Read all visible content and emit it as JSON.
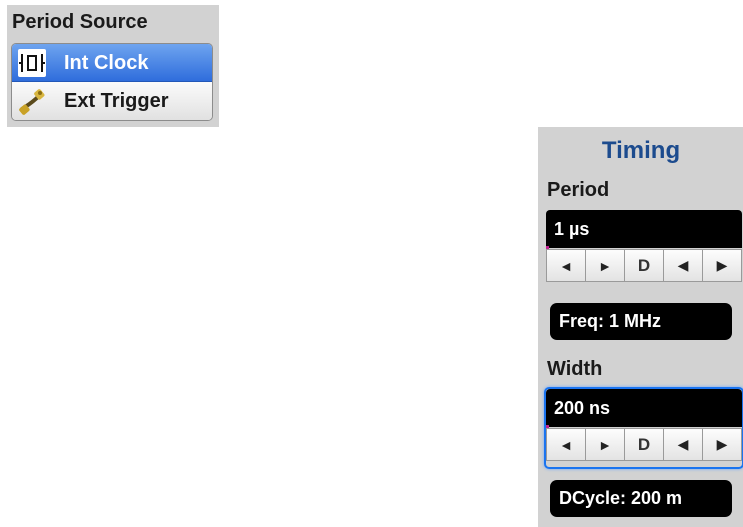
{
  "period_source": {
    "title": "Period Source",
    "options": [
      {
        "label": "Int Clock",
        "icon": "clock-signal-icon",
        "selected": true
      },
      {
        "label": "Ext Trigger",
        "icon": "trigger-cable-icon",
        "selected": false
      }
    ]
  },
  "timing": {
    "title": "Timing",
    "period": {
      "label": "Period",
      "value": "1 µs",
      "stepper": [
        "◄",
        "►",
        "D",
        "◀",
        "▶"
      ],
      "info": "Freq: 1 MHz"
    },
    "width": {
      "label": "Width",
      "value": "200 ns",
      "stepper": [
        "◄",
        "►",
        "D",
        "◀",
        "▶"
      ],
      "info": "DCycle: 200 m",
      "focused": true
    }
  },
  "colors": {
    "panel_bg": "#d2d2d2",
    "selected_blue": "#2f6ddc",
    "title_blue": "#1c4b8e",
    "focus_blue": "#1a74f0"
  }
}
